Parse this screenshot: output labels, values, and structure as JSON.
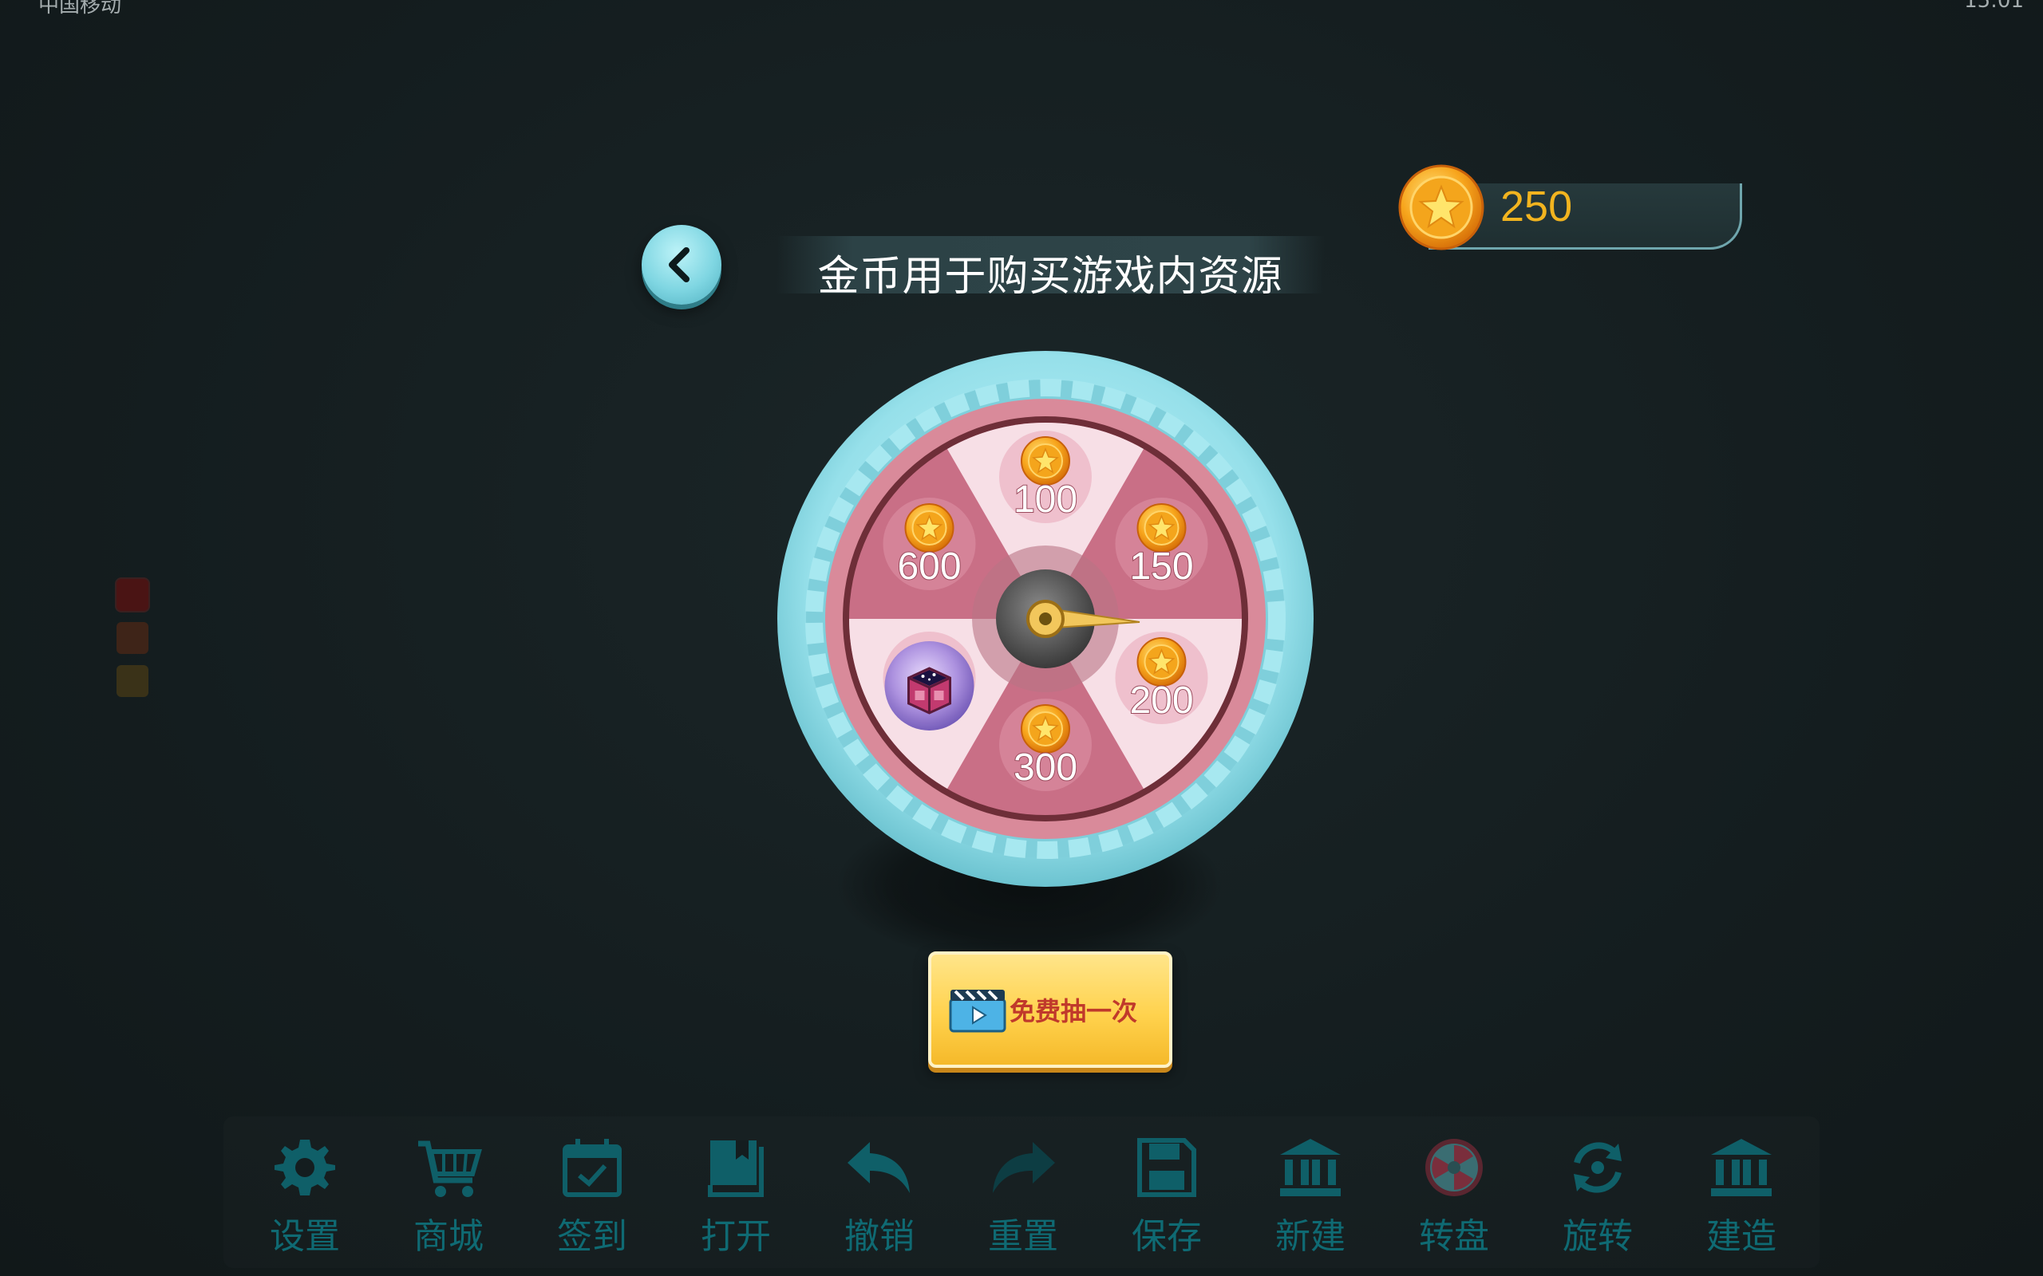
{
  "status_bar": {
    "left_text": "中国移动",
    "right_text": "15:01"
  },
  "header": {
    "title": "金币用于购买游戏内资源",
    "coin_balance": "250"
  },
  "wheel": {
    "segments": [
      {
        "type": "coin",
        "value": "100"
      },
      {
        "type": "coin",
        "value": "150"
      },
      {
        "type": "coin",
        "value": "200"
      },
      {
        "type": "coin",
        "value": "300"
      },
      {
        "type": "gift-box",
        "value": ""
      },
      {
        "type": "coin",
        "value": "600"
      }
    ],
    "colors": {
      "outer_ring": "#8fdde8",
      "rim": "#d98a9a",
      "dark_segment": "#c96f86",
      "light_segment": "#f7dfe6",
      "pointer": "#f2c75c"
    }
  },
  "spin_button": {
    "label": "免费抽一次",
    "icon": "video-play-icon"
  },
  "side_swatches": [
    "#4a1414",
    "#3e2418",
    "#3a3218"
  ],
  "toolbar": {
    "items": [
      {
        "icon": "gear-icon",
        "label": "设置"
      },
      {
        "icon": "cart-icon",
        "label": "商城"
      },
      {
        "icon": "calendar-check-icon",
        "label": "签到"
      },
      {
        "icon": "book-icon",
        "label": "打开"
      },
      {
        "icon": "undo-icon",
        "label": "撤销"
      },
      {
        "icon": "redo-icon",
        "label": "重置"
      },
      {
        "icon": "floppy-disk-icon",
        "label": "保存"
      },
      {
        "icon": "bank-icon",
        "label": "新建"
      },
      {
        "icon": "spin-wheel-icon",
        "label": "转盘"
      },
      {
        "icon": "rotate-icon",
        "label": "旋转"
      },
      {
        "icon": "bank-icon",
        "label": "建造"
      }
    ]
  }
}
